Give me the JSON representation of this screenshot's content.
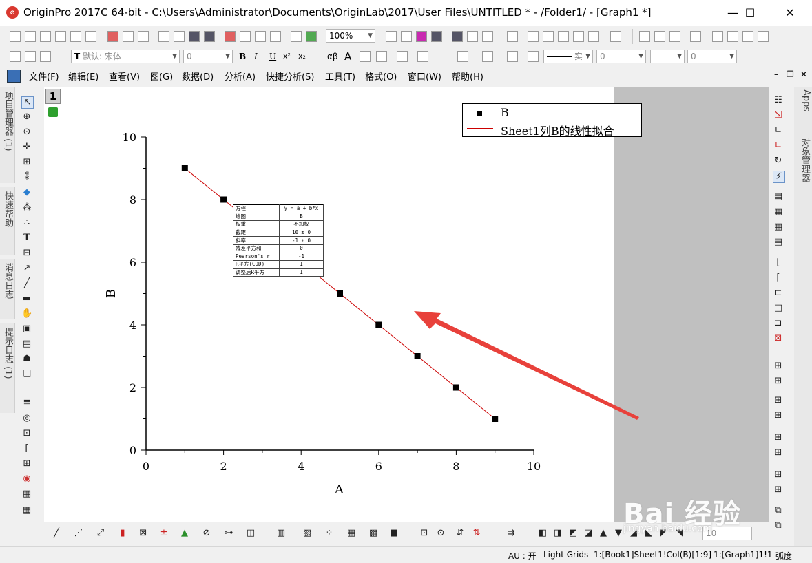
{
  "window": {
    "title": "OriginPro 2017C 64-bit - C:\\Users\\Administrator\\Documents\\OriginLab\\2017\\User Files\\UNTITLED * - /Folder1/ - [Graph1 *]",
    "minimize_glyph": "—",
    "maximize_glyph": "☐",
    "close_glyph": "✕"
  },
  "toolbar1": {
    "zoom_value": "100%"
  },
  "toolbar2": {
    "font_name": "默认: 宋体",
    "font_size": "0",
    "bold": "B",
    "italic": "I",
    "underline": "U",
    "superscript": "x²",
    "subscript": "x₂",
    "greek": "αβ",
    "grow_font": "A",
    "line_style": "实",
    "line_width": "0",
    "pattern_value": "0"
  },
  "menu": [
    "文件(F)",
    "编辑(E)",
    "查看(V)",
    "图(G)",
    "数据(D)",
    "分析(A)",
    "快捷分析(S)",
    "工具(T)",
    "格式(O)",
    "窗口(W)",
    "帮助(H)"
  ],
  "left_tabs": [
    "项目管理器 (1)",
    "快速帮助",
    "消息日志",
    "提示日志 (1)"
  ],
  "right_tabs": [
    "Apps",
    "对象管理器"
  ],
  "graph": {
    "layer_number": "1"
  },
  "legend": {
    "series_label": "B",
    "fit_label": "Sheet1列B的线性拟合"
  },
  "fit_table": [
    {
      "key": "方程",
      "value": "y = a + b*x"
    },
    {
      "key": "绘图",
      "value": "B"
    },
    {
      "key": "权重",
      "value": "不加权"
    },
    {
      "key": "截距",
      "value": "10 ± 0"
    },
    {
      "key": "斜率",
      "value": "-1 ± 0"
    },
    {
      "key": "残差平方和",
      "value": "0"
    },
    {
      "key": "Pearson's r",
      "value": "-1"
    },
    {
      "key": "R平方(COD)",
      "value": "1"
    },
    {
      "key": "调整后R平方",
      "value": "1"
    }
  ],
  "chart_data": {
    "type": "scatter",
    "xlabel": "A",
    "ylabel": "B",
    "xlim": [
      0,
      10
    ],
    "ylim": [
      0,
      10
    ],
    "xticks": [
      "0",
      "2",
      "4",
      "6",
      "8",
      "10"
    ],
    "yticks": [
      "0",
      "2",
      "4",
      "6",
      "8",
      "10"
    ],
    "series": [
      {
        "name": "B",
        "x": [
          1,
          2,
          5,
          6,
          7,
          8,
          9
        ],
        "y": [
          9,
          8,
          5,
          4,
          3,
          2,
          1
        ],
        "color": "#000000"
      }
    ],
    "fit_line": {
      "name": "Sheet1列B的线性拟合",
      "x": [
        1,
        9
      ],
      "y": [
        9,
        1
      ],
      "color": "#cc0000"
    },
    "grid": false,
    "legend_position": "top-right"
  },
  "annotation_arrow": {
    "color": "#e8413b"
  },
  "bottom_toolbar": {
    "value": "10"
  },
  "status": {
    "dash": "--",
    "au": "AU : 开",
    "grid": "Light Grids",
    "book": "1:[Book1]Sheet1!Col(B)[1:9]",
    "graph": "1:[Graph1]1!1",
    "unit": "弧度"
  },
  "watermark": {
    "main": "Bai 经验",
    "sub": "jingyan.baidu.com"
  }
}
